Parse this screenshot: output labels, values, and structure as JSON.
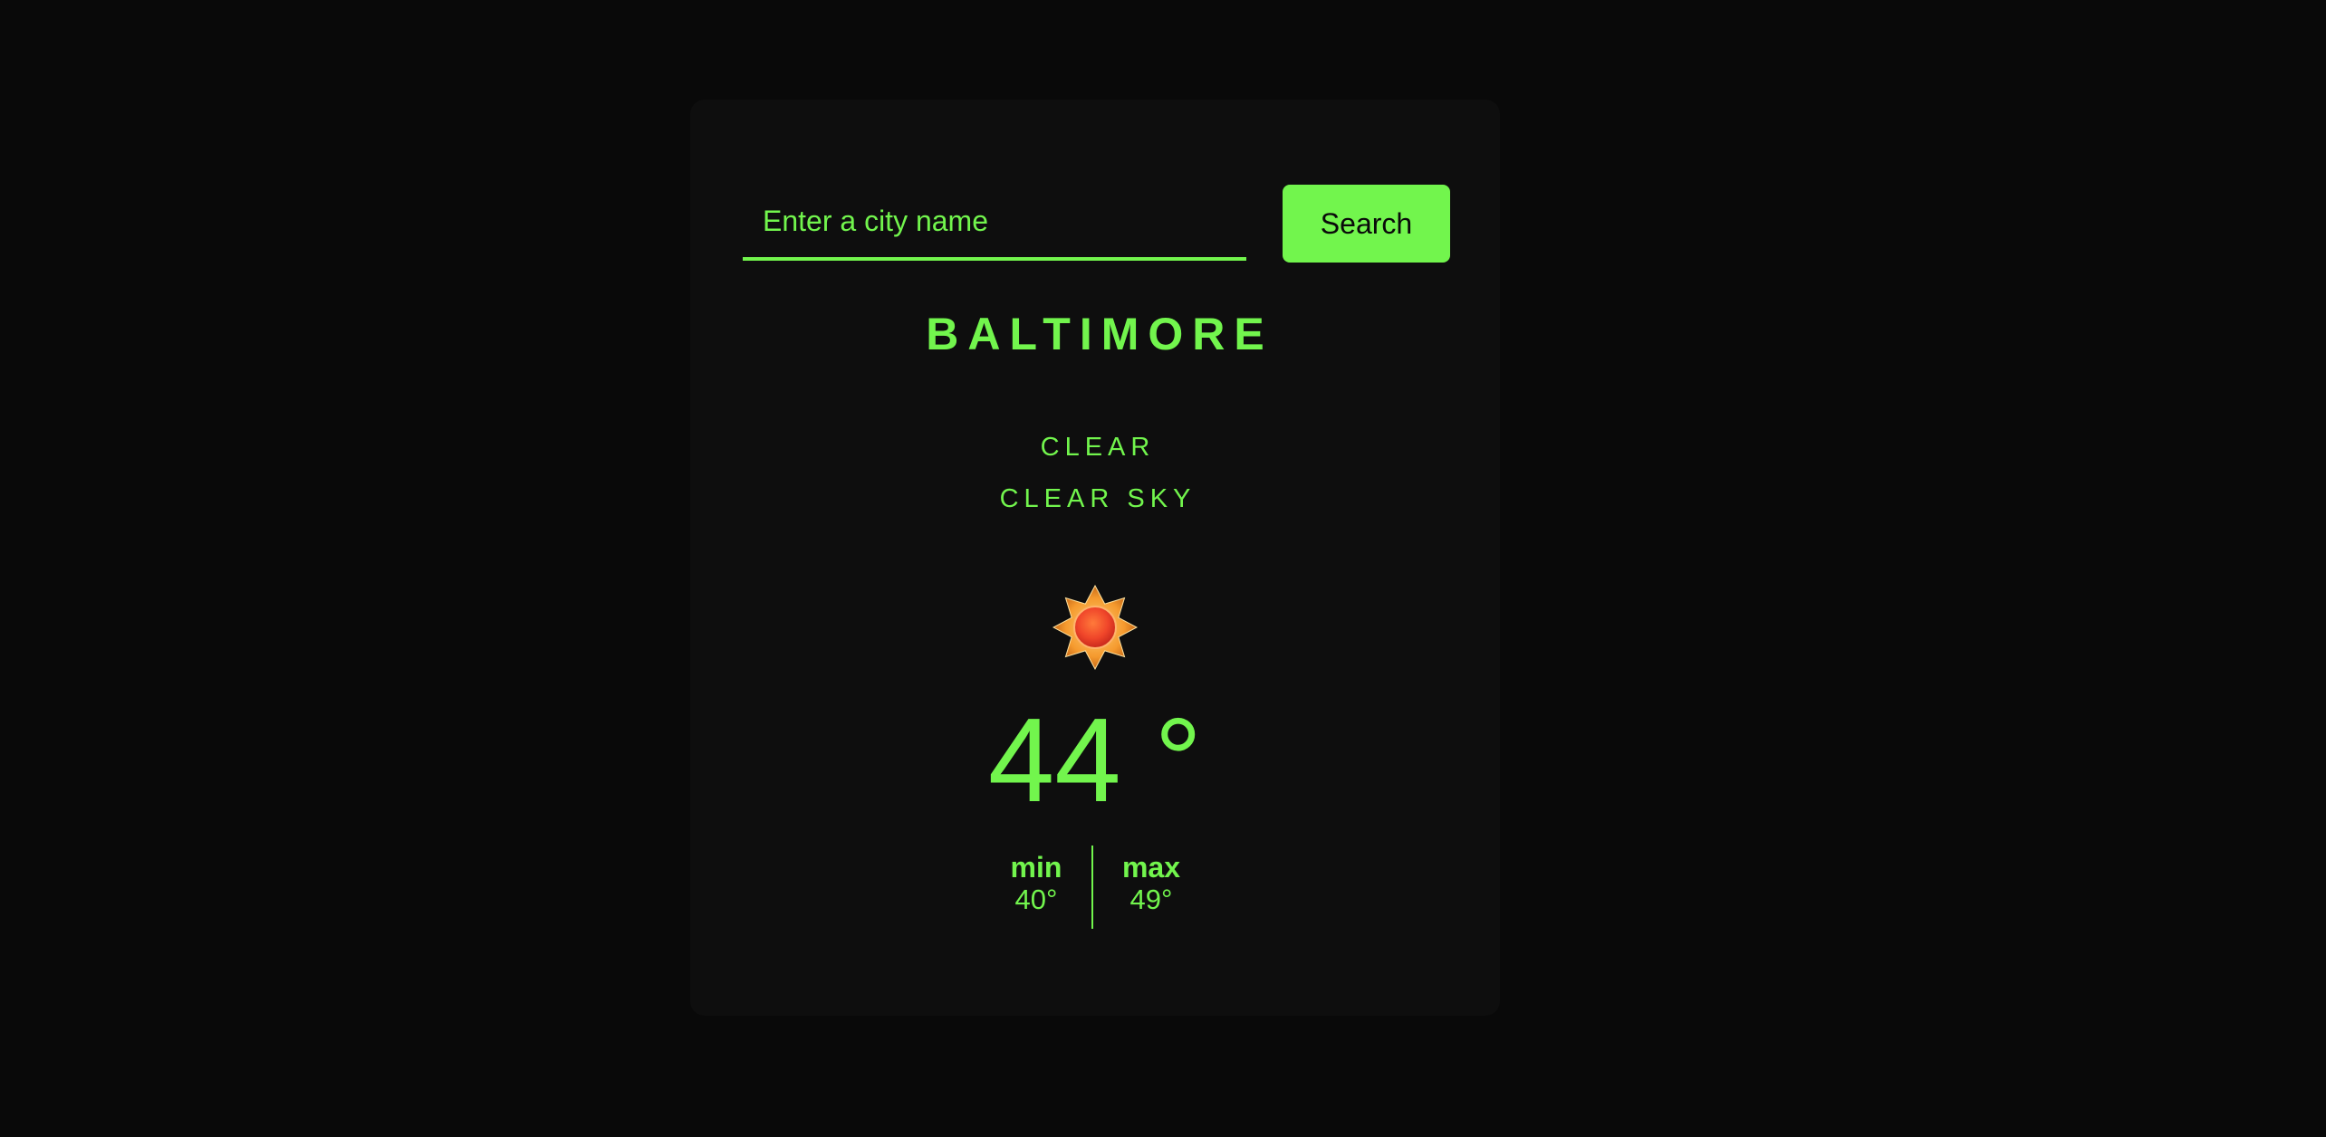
{
  "search": {
    "placeholder": "Enter a city name",
    "value": "",
    "button_label": "Search"
  },
  "weather": {
    "city": "BALTIMORE",
    "condition": "CLEAR",
    "description": "CLEAR SKY",
    "icon": "sun-icon",
    "temperature": "44 °",
    "min_label": "min",
    "min_value": "40°",
    "max_label": "max",
    "max_value": "49°"
  },
  "colors": {
    "page_background": "#090909",
    "card_background": "#0e0e0e",
    "accent": "#72f54d",
    "button_text": "#0a0a0a",
    "sun_core": "#f0462a",
    "sun_rays": "#f59a2e"
  }
}
